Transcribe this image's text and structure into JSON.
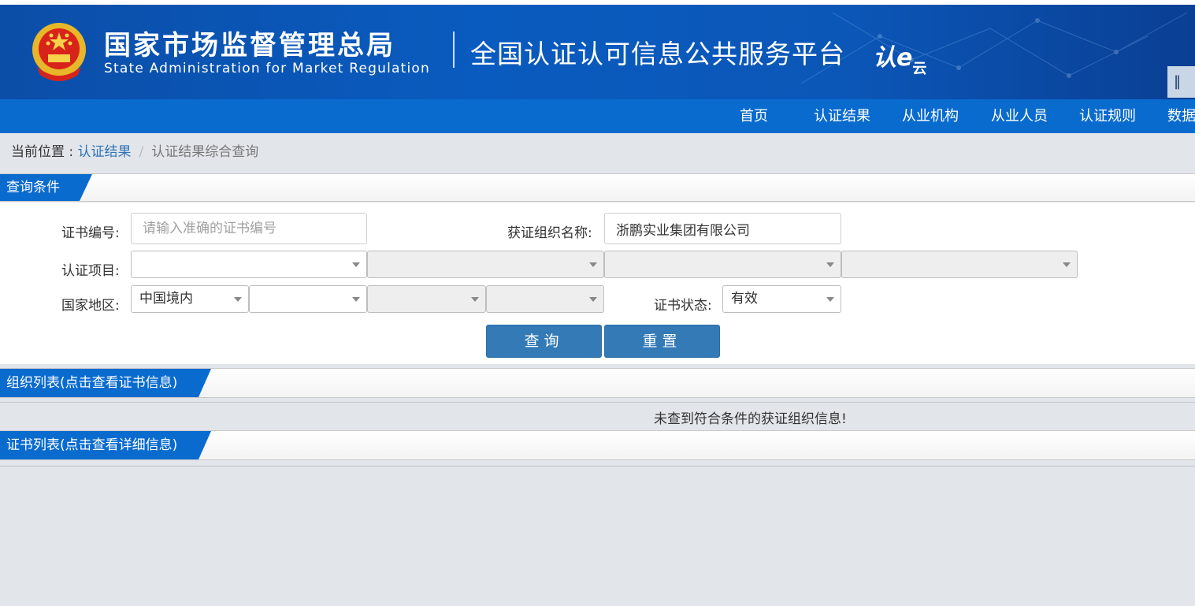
{
  "header": {
    "org_name_cn": "国家市场监督管理总局",
    "org_name_en": "State Administration  for  Market Regulation",
    "platform_title": "全国认证认可信息公共服务平台",
    "logo_text": "认e",
    "logo_sub": "云",
    "lang_button": "‖  中"
  },
  "nav": {
    "items": [
      "首页",
      "认证结果",
      "从业机构",
      "从业人员",
      "认证规则",
      "数据"
    ]
  },
  "breadcrumb": {
    "prefix": "当前位置 : ",
    "link": "认证结果",
    "separator": "/",
    "current": "认证结果综合查询"
  },
  "query_section": {
    "title": "查询条件",
    "cert_number_label": "证书编号:",
    "cert_number_placeholder": "请输入准确的证书编号",
    "cert_number_value": "",
    "org_name_label": "获证组织名称:",
    "org_name_value": "浙鹏实业集团有限公司",
    "project_label": "认证项目:",
    "project_selects": [
      "",
      "",
      "",
      ""
    ],
    "region_label": "国家地区:",
    "region_selects": [
      "中国境内",
      "",
      "",
      ""
    ],
    "status_label": "证书状态:",
    "status_value": "有效",
    "search_button": "查询",
    "reset_button": "重置"
  },
  "org_list": {
    "title": "组织列表(点击查看证书信息)",
    "empty_message": "未查到符合条件的获证组织信息!"
  },
  "cert_list": {
    "title": "证书列表(点击查看详细信息)"
  },
  "colors": {
    "banner_blue": "#0b4ea8",
    "nav_blue": "#0a6bcf",
    "button_blue": "#337ab7",
    "link_blue": "#2f74b5",
    "page_bg": "#e2e6ea"
  }
}
